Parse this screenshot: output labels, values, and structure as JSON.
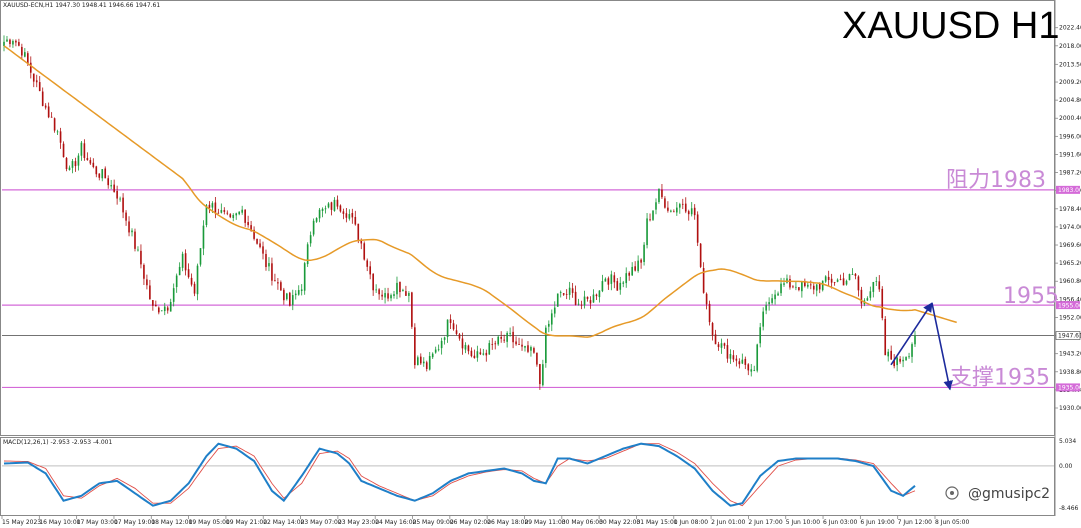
{
  "header": {
    "symbol_line": "XAUUSD-ECN,H1  1947.30 1948.41 1946.66 1947.61",
    "title": "XAUUSD H1"
  },
  "watermark": "@gmusipc2",
  "colors": {
    "bull": "#1a9a3a",
    "bear": "#b01010",
    "ma": "#e69a28",
    "level": "#d46ad8",
    "level_text": "#c98ad6",
    "macd_main": "#1f7fc8",
    "macd_signal": "#e0504a",
    "projection": "#1c2a9c",
    "current": "#444444"
  },
  "chart_data": [
    {
      "type": "candlestick",
      "name": "",
      "price_axis": {
        "min": 1930.0,
        "max": 2025.0,
        "ticks": [
          "2022.40",
          "2018.00",
          "2013.50",
          "2009.20",
          "2004.80",
          "2000.40",
          "1996.00",
          "1991.60",
          "1987.20",
          "1982.90",
          "1978.40",
          "1974.00",
          "1969.60",
          "1965.20",
          "1960.80",
          "1956.40",
          "1952.00",
          "1947.61",
          "1943.20",
          "1938.80",
          "1934.40",
          "1930.00"
        ]
      },
      "time_axis": [
        "15 May 2023",
        "16 May 10:00",
        "17 May 03:00",
        "17 May 19:00",
        "18 May 12:00",
        "19 May 05:00",
        "19 May 21:00",
        "22 May 14:00",
        "23 May 07:00",
        "23 May 23:00",
        "24 May 16:00",
        "25 May 09:00",
        "26 May 02:00",
        "26 May 18:00",
        "29 May 11:00",
        "30 May 06:00",
        "30 May 22:00",
        "31 May 15:00",
        "1 Jun 08:00",
        "2 Jun 01:00",
        "2 Jun 17:00",
        "5 Jun 10:00",
        "6 Jun 03:00",
        "6 Jun 19:00",
        "7 Jun 12:00",
        "8 Jun 05:00"
      ],
      "levels": [
        {
          "label": "阻力1983",
          "value": 1983.0,
          "tag": "1983.00"
        },
        {
          "label": "1955",
          "value": 1955.0,
          "tag": "1955.00"
        },
        {
          "label": "支撑1935",
          "value": 1935.0,
          "tag": "1935.00"
        }
      ],
      "current_price": 1947.61,
      "current_tag": "1947.61",
      "anchors": [
        [
          0,
          2019
        ],
        [
          3,
          2020
        ],
        [
          6,
          2017
        ],
        [
          10,
          2010
        ],
        [
          14,
          2003
        ],
        [
          18,
          1997
        ],
        [
          22,
          1987
        ],
        [
          26,
          1993
        ],
        [
          30,
          1988
        ],
        [
          34,
          1986
        ],
        [
          38,
          1982
        ],
        [
          42,
          1974
        ],
        [
          46,
          1965
        ],
        [
          50,
          1954
        ],
        [
          55,
          1955
        ],
        [
          60,
          1966
        ],
        [
          64,
          1958
        ],
        [
          68,
          1980
        ],
        [
          72,
          1978
        ],
        [
          76,
          1975
        ],
        [
          80,
          1978
        ],
        [
          84,
          1972
        ],
        [
          88,
          1965
        ],
        [
          92,
          1960
        ],
        [
          96,
          1955
        ],
        [
          100,
          1960
        ],
        [
          104,
          1977
        ],
        [
          108,
          1978
        ],
        [
          112,
          1980
        ],
        [
          116,
          1977
        ],
        [
          120,
          1970
        ],
        [
          124,
          1960
        ],
        [
          128,
          1957
        ],
        [
          132,
          1960
        ],
        [
          136,
          1958
        ],
        [
          138,
          1942
        ],
        [
          142,
          1940
        ],
        [
          146,
          1945
        ],
        [
          150,
          1952
        ],
        [
          154,
          1946
        ],
        [
          158,
          1942
        ],
        [
          162,
          1944
        ],
        [
          166,
          1946
        ],
        [
          170,
          1947
        ],
        [
          174,
          1944
        ],
        [
          178,
          1943
        ],
        [
          180,
          1936
        ],
        [
          182,
          1948
        ],
        [
          186,
          1957
        ],
        [
          190,
          1958
        ],
        [
          194,
          1955
        ],
        [
          198,
          1957
        ],
        [
          202,
          1962
        ],
        [
          206,
          1960
        ],
        [
          210,
          1963
        ],
        [
          214,
          1965
        ],
        [
          216,
          1975
        ],
        [
          220,
          1982
        ],
        [
          224,
          1978
        ],
        [
          228,
          1980
        ],
        [
          232,
          1977
        ],
        [
          234,
          1963
        ],
        [
          238,
          1948
        ],
        [
          242,
          1944
        ],
        [
          246,
          1942
        ],
        [
          250,
          1940
        ],
        [
          252,
          1938
        ],
        [
          254,
          1950
        ],
        [
          258,
          1958
        ],
        [
          262,
          1960
        ],
        [
          266,
          1960
        ],
        [
          270,
          1959
        ],
        [
          274,
          1960
        ],
        [
          278,
          1961
        ],
        [
          282,
          1961
        ],
        [
          286,
          1962
        ],
        [
          288,
          1955
        ],
        [
          292,
          1961
        ],
        [
          294,
          1958
        ],
        [
          296,
          1943
        ],
        [
          300,
          1941
        ],
        [
          304,
          1944
        ],
        [
          306,
          1948
        ]
      ],
      "ma_period": 100,
      "x_count": 307
    },
    {
      "type": "line",
      "name": "MACD(12,26,1) -2.953 -2.953 -4.001",
      "yticks": [
        "5.034",
        "0.00",
        "-8.466"
      ],
      "ylim": [
        -8.466,
        5.034
      ],
      "series": [
        {
          "name": "MACD",
          "anchors": [
            [
              0,
              0.5
            ],
            [
              8,
              0.7
            ],
            [
              14,
              -1.5
            ],
            [
              20,
              -7.0
            ],
            [
              26,
              -6.0
            ],
            [
              32,
              -3.5
            ],
            [
              38,
              -3.0
            ],
            [
              44,
              -5.5
            ],
            [
              50,
              -8.0
            ],
            [
              56,
              -7.0
            ],
            [
              62,
              -3.5
            ],
            [
              68,
              2.0
            ],
            [
              72,
              4.5
            ],
            [
              78,
              3.5
            ],
            [
              84,
              1.0
            ],
            [
              90,
              -5.0
            ],
            [
              94,
              -7.0
            ],
            [
              100,
              -2.0
            ],
            [
              106,
              3.5
            ],
            [
              112,
              2.5
            ],
            [
              116,
              0.5
            ],
            [
              120,
              -3.0
            ],
            [
              126,
              -4.5
            ],
            [
              132,
              -6.0
            ],
            [
              138,
              -7.0
            ],
            [
              144,
              -5.5
            ],
            [
              150,
              -3.0
            ],
            [
              156,
              -1.5
            ],
            [
              162,
              -1.0
            ],
            [
              168,
              -0.5
            ],
            [
              174,
              -1.5
            ],
            [
              178,
              -3.0
            ],
            [
              182,
              -3.5
            ],
            [
              186,
              1.5
            ],
            [
              190,
              1.5
            ],
            [
              196,
              0.5
            ],
            [
              202,
              2.0
            ],
            [
              208,
              3.5
            ],
            [
              214,
              4.5
            ],
            [
              220,
              4.0
            ],
            [
              226,
              2.0
            ],
            [
              232,
              -0.5
            ],
            [
              238,
              -5.0
            ],
            [
              244,
              -8.0
            ],
            [
              248,
              -7.5
            ],
            [
              254,
              -2.0
            ],
            [
              260,
              1.0
            ],
            [
              266,
              1.5
            ],
            [
              272,
              1.5
            ],
            [
              280,
              1.5
            ],
            [
              286,
              1.0
            ],
            [
              292,
              0.0
            ],
            [
              298,
              -5.0
            ],
            [
              302,
              -6.0
            ],
            [
              306,
              -4.0
            ]
          ]
        },
        {
          "name": "Signal",
          "anchors": [
            [
              0,
              1.0
            ],
            [
              8,
              0.9
            ],
            [
              14,
              -0.5
            ],
            [
              20,
              -6.0
            ],
            [
              26,
              -6.5
            ],
            [
              32,
              -4.0
            ],
            [
              38,
              -2.5
            ],
            [
              44,
              -4.5
            ],
            [
              50,
              -7.5
            ],
            [
              56,
              -7.5
            ],
            [
              62,
              -4.5
            ],
            [
              68,
              0.5
            ],
            [
              72,
              3.5
            ],
            [
              78,
              4.0
            ],
            [
              84,
              2.0
            ],
            [
              90,
              -3.5
            ],
            [
              94,
              -6.5
            ],
            [
              100,
              -3.5
            ],
            [
              106,
              2.5
            ],
            [
              112,
              3.0
            ],
            [
              116,
              1.5
            ],
            [
              120,
              -2.0
            ],
            [
              126,
              -4.0
            ],
            [
              132,
              -5.5
            ],
            [
              138,
              -7.0
            ],
            [
              144,
              -6.0
            ],
            [
              150,
              -3.5
            ],
            [
              156,
              -2.0
            ],
            [
              162,
              -1.2
            ],
            [
              168,
              -0.7
            ],
            [
              174,
              -1.0
            ],
            [
              178,
              -2.5
            ],
            [
              182,
              -3.5
            ],
            [
              186,
              0.0
            ],
            [
              190,
              1.5
            ],
            [
              196,
              1.0
            ],
            [
              202,
              1.5
            ],
            [
              208,
              3.0
            ],
            [
              214,
              4.5
            ],
            [
              220,
              4.5
            ],
            [
              226,
              2.8
            ],
            [
              232,
              0.5
            ],
            [
              238,
              -3.5
            ],
            [
              244,
              -7.0
            ],
            [
              248,
              -8.0
            ],
            [
              254,
              -4.0
            ],
            [
              260,
              0.0
            ],
            [
              266,
              1.2
            ],
            [
              272,
              1.5
            ],
            [
              280,
              1.6
            ],
            [
              286,
              1.2
            ],
            [
              292,
              0.5
            ],
            [
              298,
              -3.5
            ],
            [
              302,
              -6.0
            ],
            [
              306,
              -5.0
            ]
          ]
        }
      ]
    }
  ]
}
